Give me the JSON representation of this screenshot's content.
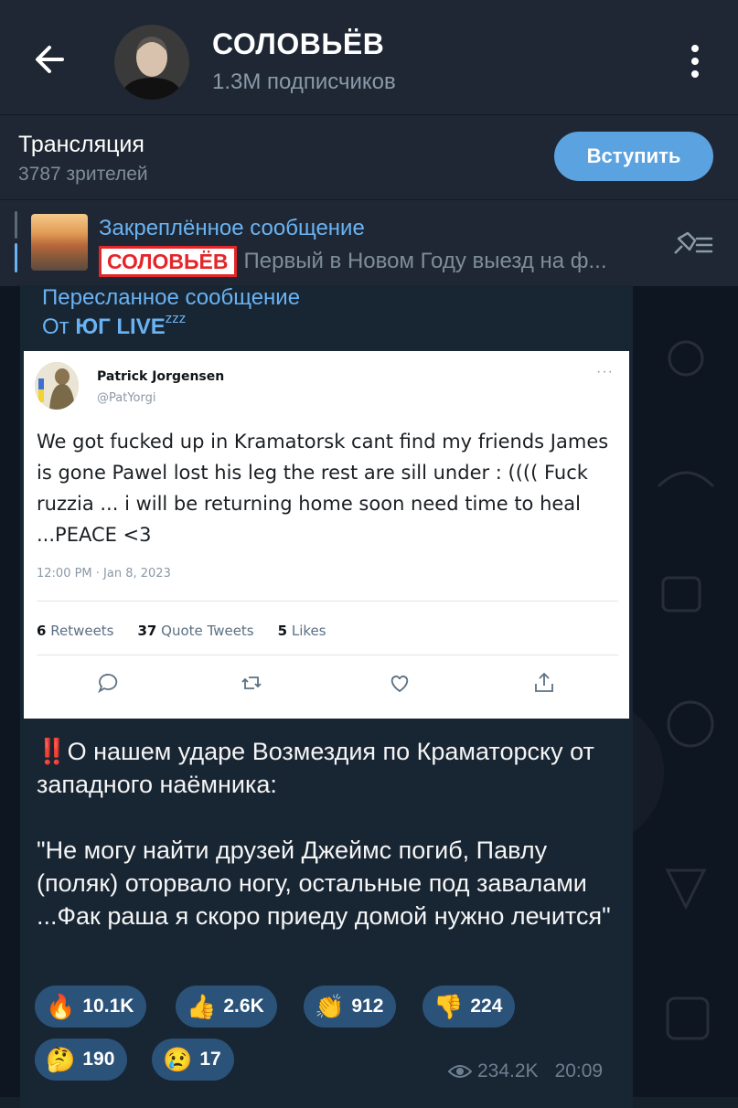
{
  "header": {
    "title": "СОЛОВЬЁВ",
    "subtitle": "1.3M подписчиков"
  },
  "live": {
    "title": "Трансляция",
    "viewers": "3787 зрителей",
    "join_label": "Вступить"
  },
  "pinned": {
    "label": "Закреплённое сообщение",
    "tag": "СОЛОВЬЁВ",
    "preview": "Первый в Новом Году выезд на ф..."
  },
  "message": {
    "forwarded_label": "Пересланное сообщение",
    "from_prefix": "От",
    "from_name": "ЮГ LIVE",
    "from_suffix": "zzz",
    "tweet": {
      "name": "Patrick Jorgensen",
      "handle": "@PatYorgi",
      "body": "We got fucked up in Kramatorsk cant find my friends James is gone Pawel lost his leg the rest are sill under : (((( Fuck ruzzia ... i will be returning home soon need time to heal ...PEACE <3",
      "time": "12:00 PM · Jan 8, 2023",
      "retweets_count": "6",
      "retweets_label": "Retweets",
      "quotes_count": "37",
      "quotes_label": "Quote Tweets",
      "likes_count": "5",
      "likes_label": "Likes"
    },
    "bang": "‼️",
    "text_line1": "О нашем ударе Возмездия по Краматорску от западного наёмника:",
    "text_quote": "\"Не могу найти друзей Джеймс погиб, Павлу (поляк) оторвало ногу, остальные под завалами ...Фак раша я скоро приеду домой нужно лечится\"",
    "reactions": [
      {
        "emoji": "🔥",
        "count": "10.1K"
      },
      {
        "emoji": "👍",
        "count": "2.6K"
      },
      {
        "emoji": "👏",
        "count": "912"
      },
      {
        "emoji": "👎",
        "count": "224"
      },
      {
        "emoji": "🤔",
        "count": "190"
      },
      {
        "emoji": "😢",
        "count": "17"
      }
    ],
    "views": "234.2K",
    "time": "20:09"
  },
  "icons": {
    "back": "arrow-left-icon",
    "more": "more-vertical-icon",
    "unpin": "pin-list-icon",
    "eye": "eye-icon"
  },
  "colors": {
    "accent": "#6ab3f3",
    "join_button": "#5ba2e0",
    "reaction_bg": "#2b5278"
  }
}
